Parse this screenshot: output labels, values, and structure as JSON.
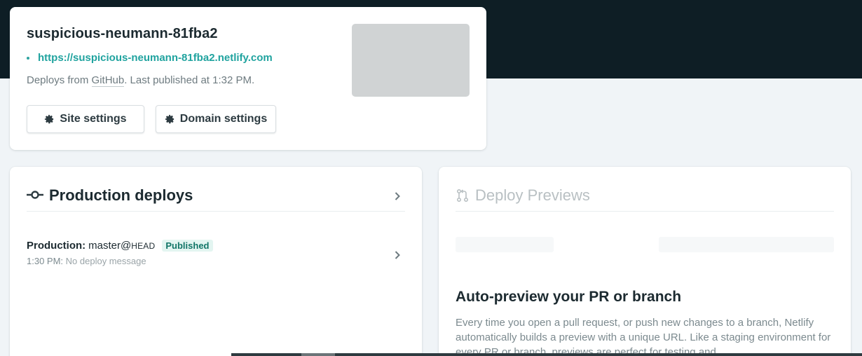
{
  "site": {
    "name": "suspicious-neumann-81fba2",
    "url": "https://suspicious-neumann-81fba2.netlify.com",
    "deploy_prefix": "Deploys from ",
    "deploy_source": "GitHub",
    "deploy_suffix": ". Last published at 1:32 PM.",
    "buttons": {
      "site_settings": "Site settings",
      "domain_settings": "Domain settings"
    }
  },
  "production": {
    "title": "Production deploys",
    "deploy": {
      "label": "Production:",
      "branch": "master@",
      "ref": "HEAD",
      "status": "Published",
      "time": "1:30 PM:",
      "message": "No deploy message"
    }
  },
  "previews": {
    "title": "Deploy Previews",
    "heading": "Auto-preview your PR or branch",
    "description": "Every time you open a pull request, or push new changes to a branch, Netlify automatically builds a preview with a unique URL. Like a staging environment for every PR or branch, previews are perfect for testing and"
  },
  "colors": {
    "header_bg": "#0e1e25",
    "accent": "#20a39f",
    "badge_bg": "#e3f5f1",
    "badge_text": "#117567"
  },
  "icons": [
    "gear-icon",
    "commit-icon",
    "chevron-right-icon",
    "pull-request-icon"
  ]
}
